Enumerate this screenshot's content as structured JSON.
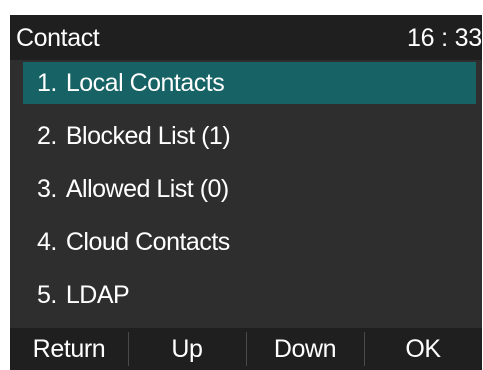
{
  "header": {
    "title": "Contact",
    "time": "16 : 33"
  },
  "menu": {
    "selected_index": 0,
    "items": [
      {
        "num": "1.",
        "label": "Local Contacts"
      },
      {
        "num": "2.",
        "label": "Blocked List (1)"
      },
      {
        "num": "3.",
        "label": "Allowed List (0)"
      },
      {
        "num": "4.",
        "label": "Cloud Contacts"
      },
      {
        "num": "5.",
        "label": "LDAP"
      }
    ]
  },
  "softkeys": {
    "return": "Return",
    "up": "Up",
    "down": "Down",
    "ok": "OK"
  },
  "colors": {
    "screen_background": "#2e2e2e",
    "bar_background": "#1f1f1f",
    "selection_highlight": "#176265",
    "text": "#ffffff"
  }
}
